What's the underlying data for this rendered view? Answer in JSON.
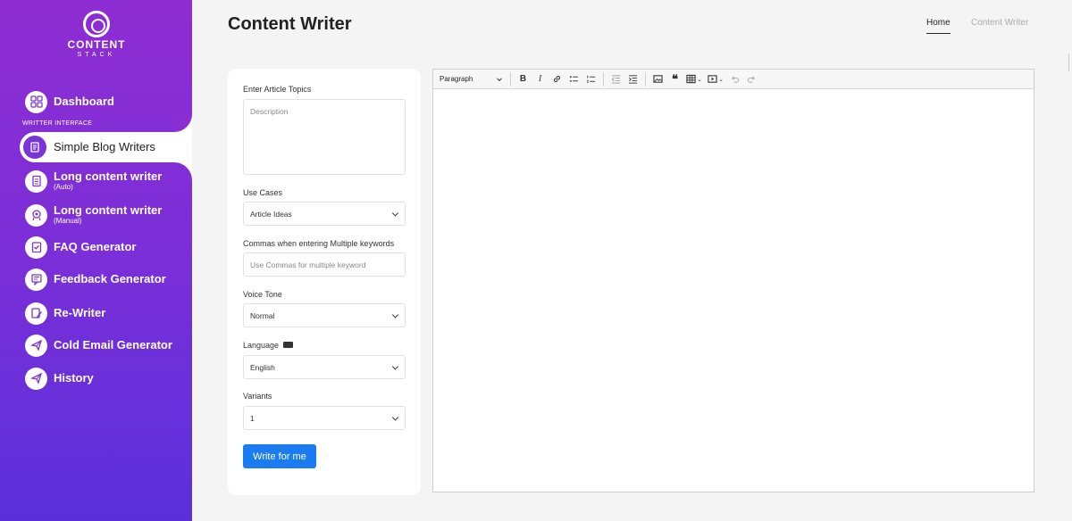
{
  "brand": {
    "line1": "CONTENT",
    "line2": "STACK"
  },
  "sidebar": {
    "section_label": "WRITTER INTERFACE",
    "items": [
      {
        "label": "Dashboard",
        "icon": "dashboard-icon"
      },
      {
        "label": "Simple Blog Writers",
        "icon": "blog-icon",
        "active": true
      },
      {
        "label": "Long content writer",
        "sub": "(Auto)",
        "icon": "document-icon"
      },
      {
        "label": "Long content writer",
        "sub": "(Manual)",
        "icon": "manual-icon"
      },
      {
        "label": "FAQ Generator",
        "icon": "faq-icon"
      },
      {
        "label": "Feedback Generator",
        "icon": "feedback-icon"
      },
      {
        "label": "Re-Writer",
        "icon": "rewrite-icon"
      },
      {
        "label": "Cold Email Generator",
        "icon": "email-icon"
      },
      {
        "label": "History",
        "icon": "history-icon"
      }
    ]
  },
  "header": {
    "title": "Content Writer",
    "breadcrumb": {
      "home": "Home",
      "current": "Content Writer"
    }
  },
  "form": {
    "topics_label": "Enter Article Topics",
    "topics_placeholder": "Description",
    "use_cases_label": "Use Cases",
    "use_cases_value": "Article Ideas",
    "keywords_label": "Commas when entering Multiple keywords",
    "keywords_placeholder": "Use Commas for multiple keyword",
    "voice_label": "Voice Tone",
    "voice_value": "Normal",
    "language_label": "Language",
    "language_value": "English",
    "variants_label": "Variants",
    "variants_value": "1",
    "submit_label": "Write for me"
  },
  "editor": {
    "block_format": "Paragraph",
    "bold": "B",
    "italic": "I",
    "quote": "❝"
  },
  "colors": {
    "sidebar_top": "#8e2dd2",
    "sidebar_bottom": "#5a30db",
    "button": "#1a7cf0"
  }
}
